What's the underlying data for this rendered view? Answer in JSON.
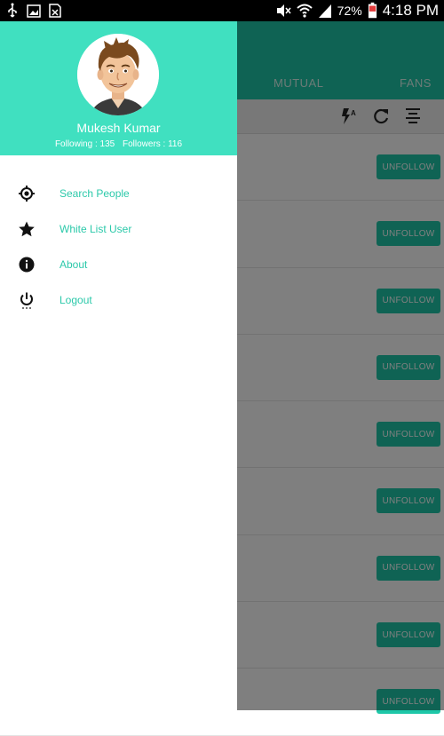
{
  "status_bar": {
    "battery_percent": "72%",
    "time": "4:18 PM"
  },
  "app": {
    "tabs": [
      "MUTUAL",
      "FANS"
    ],
    "rows": [
      {
        "button_label": "UNFOLLOW"
      },
      {
        "button_label": "UNFOLLOW"
      },
      {
        "button_label": "UNFOLLOW"
      },
      {
        "button_label": "UNFOLLOW"
      },
      {
        "button_label": "UNFOLLOW"
      },
      {
        "button_label": "UNFOLLOW"
      },
      {
        "button_label": "UNFOLLOW"
      },
      {
        "button_label": "UNFOLLOW"
      },
      {
        "button_label": "UNFOLLOW"
      }
    ]
  },
  "drawer": {
    "profile": {
      "name": "Mukesh Kumar",
      "following": "Following : 135",
      "followers": "Followers : 116"
    },
    "menu": [
      {
        "label": "Search People",
        "icon": "crosshair-icon"
      },
      {
        "label": "White List User",
        "icon": "star-icon"
      },
      {
        "label": "About",
        "icon": "info-icon"
      },
      {
        "label": "Logout",
        "icon": "power-icon"
      }
    ]
  },
  "colors": {
    "accent": "#40e0c0",
    "toolbar": "#1ec7a8",
    "menu_text": "#2cc9aa"
  }
}
